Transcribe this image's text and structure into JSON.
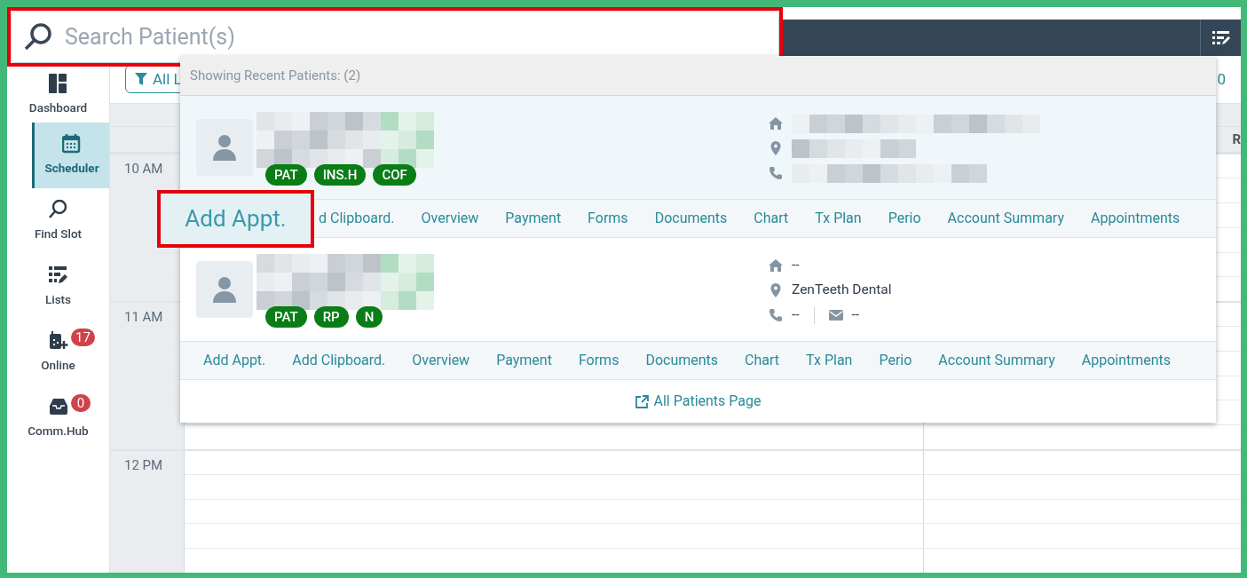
{
  "search": {
    "placeholder": "Search Patient(s)"
  },
  "sidebar": {
    "items": [
      {
        "label": "Dashboard",
        "kind": "dashboard",
        "selected": false
      },
      {
        "label": "Scheduler",
        "kind": "calendar",
        "selected": true
      },
      {
        "label": "Find Slot",
        "kind": "search",
        "selected": false
      },
      {
        "label": "Lists",
        "kind": "lists",
        "selected": false
      },
      {
        "label": "Online",
        "kind": "online",
        "selected": false,
        "badge": "17"
      },
      {
        "label": "Comm.Hub",
        "kind": "inbox",
        "selected": false,
        "badge": "0"
      }
    ]
  },
  "toolbar": {
    "filter_button": "All L",
    "column_4": "0"
  },
  "calendar": {
    "column_header": "R",
    "times": [
      "10 AM",
      "11 AM",
      "12 PM"
    ]
  },
  "recent": {
    "title": "Showing Recent Patients:  (2)",
    "patients": [
      {
        "selected": true,
        "tags": [
          "PAT",
          "INS.H",
          "COF"
        ],
        "contacts": [
          {
            "kind": "home"
          },
          {
            "kind": "location"
          },
          {
            "kind": "phone"
          }
        ],
        "actions": [
          "d Clipboard.",
          "Overview",
          "Payment",
          "Forms",
          "Documents",
          "Chart",
          "Tx Plan",
          "Perio",
          "Account Summary",
          "Appointments"
        ]
      },
      {
        "selected": false,
        "tags": [
          "PAT",
          "RP",
          "N"
        ],
        "contacts": [
          {
            "kind": "home",
            "value": "--"
          },
          {
            "kind": "location",
            "value": "ZenTeeth Dental"
          },
          {
            "kind": "phone",
            "value": "--"
          },
          {
            "kind": "email",
            "value": "--"
          }
        ],
        "actions": [
          "Add Appt.",
          "Add Clipboard.",
          "Overview",
          "Payment",
          "Forms",
          "Documents",
          "Chart",
          "Tx Plan",
          "Perio",
          "Account Summary",
          "Appointments"
        ]
      }
    ],
    "footer_link": "All Patients Page"
  },
  "callout": {
    "label": "Add Appt."
  }
}
